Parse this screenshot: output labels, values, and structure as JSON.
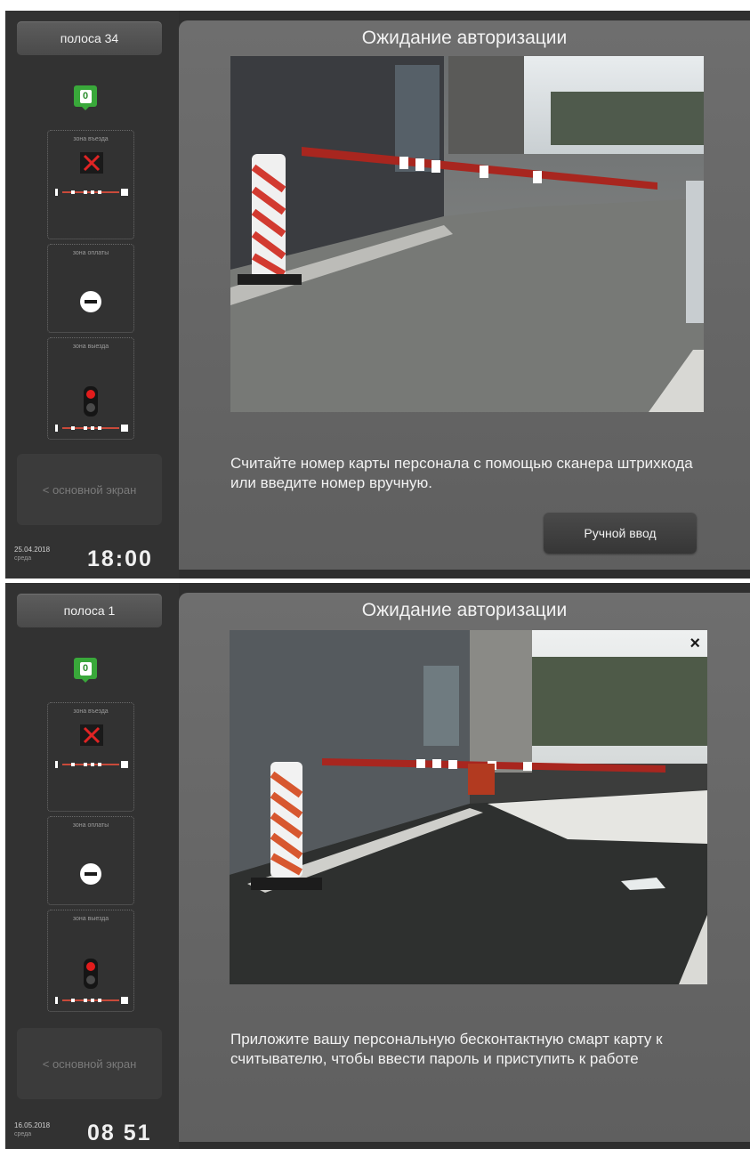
{
  "screens": [
    {
      "lane_label": "полоса 34",
      "counter": "0",
      "zones": [
        "зона въезда",
        "зона оплаты",
        "зона выезда"
      ],
      "back_label": "< основной экран",
      "date": "25.04.2018",
      "weekday": "среда",
      "time": "18:00",
      "title": "Ожидание авторизации",
      "instruction": "Считайте номер карты персонала с помощью сканера штрихкода или введите номер вручную.",
      "manual_button": "Ручной ввод"
    },
    {
      "lane_label": "полоса 1",
      "counter": "0",
      "zones": [
        "зона въезда",
        "зона оплаты",
        "зона выезда"
      ],
      "back_label": "< основной экран",
      "date": "16.05.2018",
      "weekday": "среда",
      "time": "08 51",
      "title": "Ожидание авторизации",
      "instruction": "Приложите вашу персональную бесконтактную смарт карту к считывателю, чтобы ввести пароль и приступить к работе",
      "close_icon": "×"
    }
  ],
  "icons": [
    "barrier-closed-x-icon",
    "no-entry-icon",
    "traffic-light-red-icon",
    "barrier-mini-icon",
    "close-icon"
  ],
  "colors": {
    "counter_green": "#39a83a",
    "signal_red": "#e21c1c",
    "panel_bg": "#2f2f2f"
  }
}
